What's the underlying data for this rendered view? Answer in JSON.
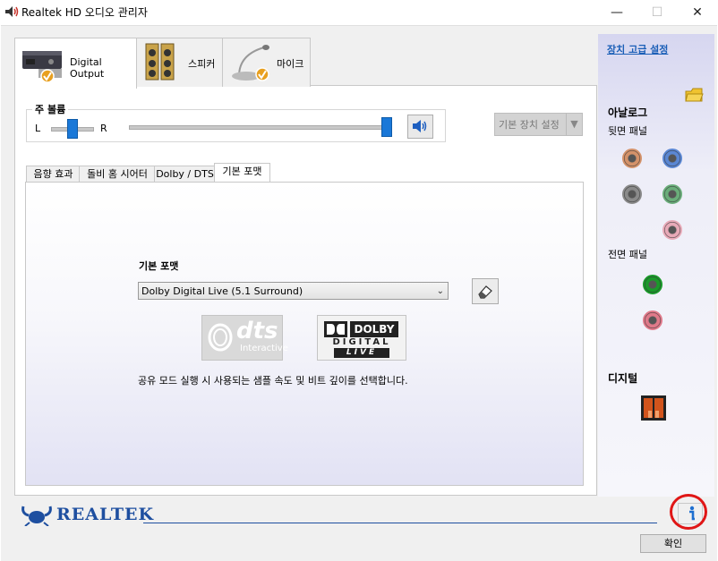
{
  "window": {
    "title": "Realtek HD 오디오 관리자",
    "min_glyph": "—",
    "max_glyph": "☐",
    "close_glyph": "✕"
  },
  "device_tabs": [
    {
      "label": "Digital Output",
      "active": true
    },
    {
      "label": "스피커",
      "active": false
    },
    {
      "label": "마이크",
      "active": false
    }
  ],
  "volume": {
    "label": "주 볼륨",
    "left_label": "L",
    "right_label": "R",
    "balance": 0.5,
    "level": 1.0
  },
  "default_device_button": "기본 장치 설정",
  "inner_tabs": [
    {
      "label": "음향 효과",
      "active": false
    },
    {
      "label": "돌비 홈 시어터",
      "active": false
    },
    {
      "label": "Dolby / DTS",
      "active": false
    },
    {
      "label": "기본 포맷",
      "active": true
    }
  ],
  "format": {
    "label": "기본 포맷",
    "selected": "Dolby Digital Live (5.1 Surround)",
    "description": "공유 모드 실행 시 사용되는 샘플 속도 및 비트 깊이를 선택합니다."
  },
  "logos": {
    "dts_main": "dts",
    "dts_sub": "Interactive",
    "dolby_lines": [
      "DOLBY",
      "DIGITAL",
      "LIVE"
    ]
  },
  "right_panel": {
    "advanced_link": "장치 고급 설정",
    "analog_title": "아날로그",
    "rear_panel_label": "뒷면 패널",
    "front_panel_label": "전면 패널",
    "digital_title": "디지털",
    "rear_jack_colors": [
      "#d4926a",
      "#5b87d3",
      "#8a8a8a",
      "#6aad7a",
      "#e8aab8"
    ],
    "front_jack_colors": [
      "#1a9a2a",
      "#e07a8a"
    ]
  },
  "brand": "REALTEK",
  "ok_button": "확인"
}
